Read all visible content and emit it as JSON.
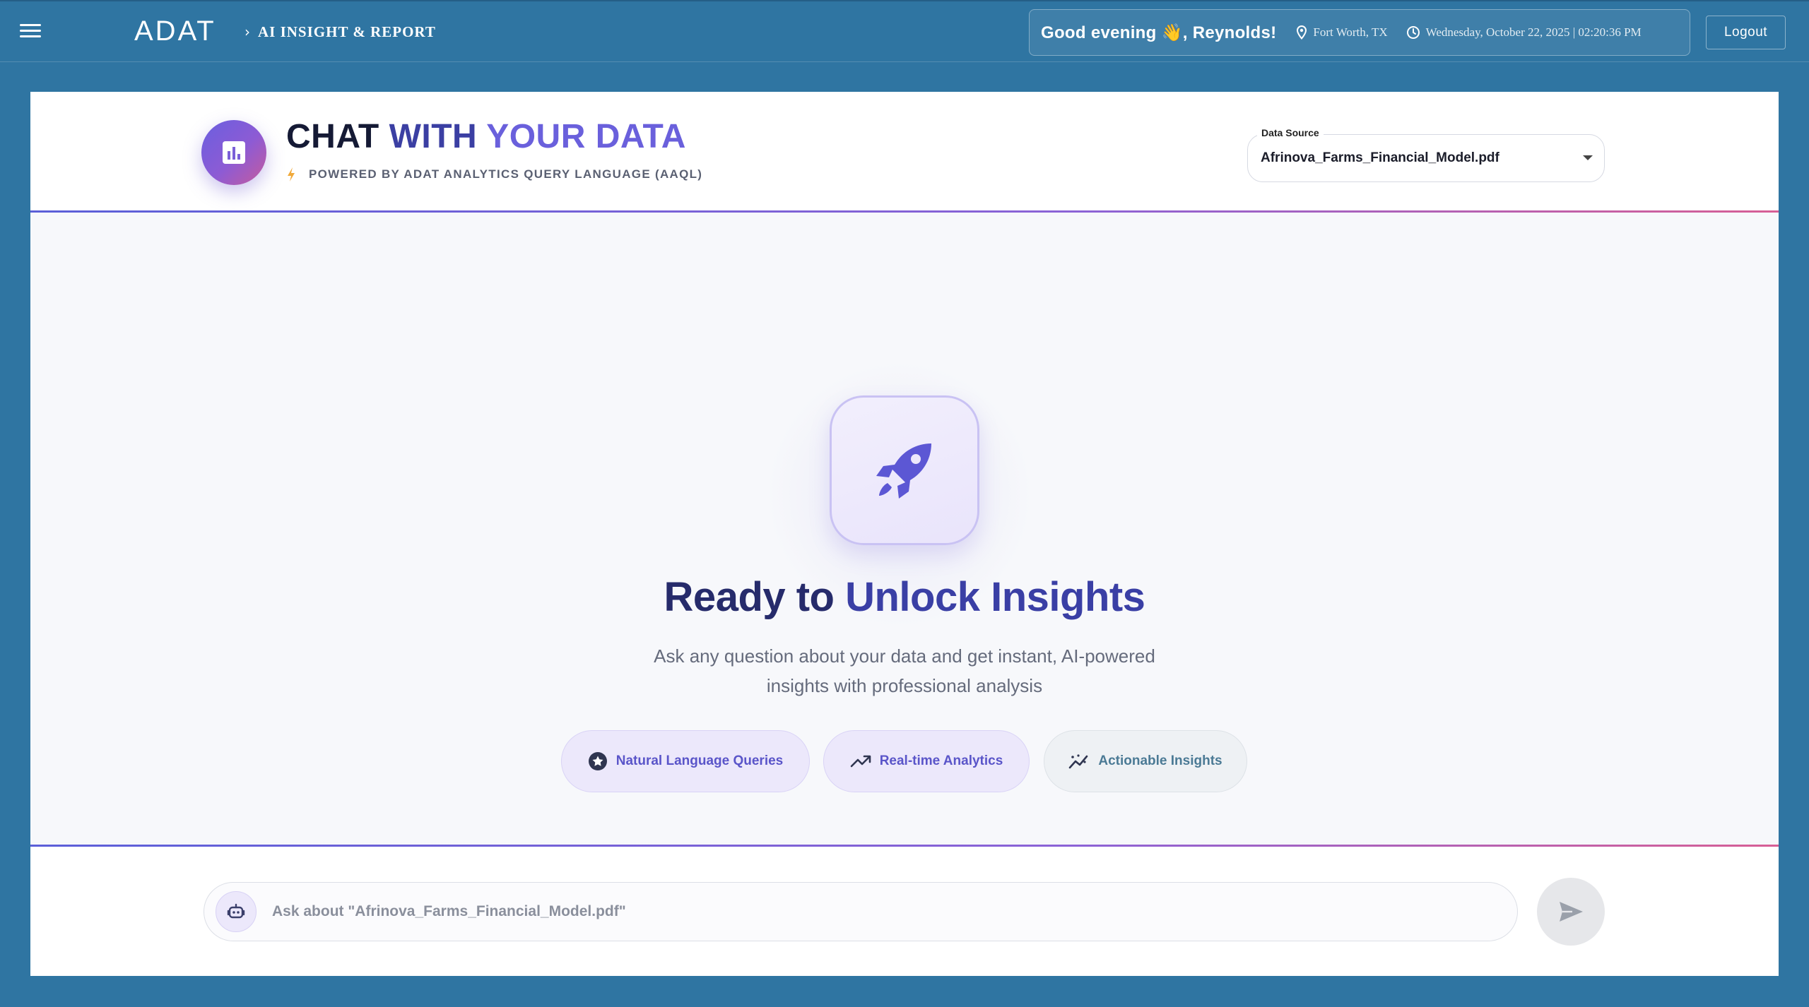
{
  "header": {
    "brand": "ADAT",
    "breadcrumb": "AI INSIGHT & REPORT",
    "greeting": "Good evening 👋, Reynolds!",
    "location": "Fort Worth, TX",
    "datetime": "Wednesday, October 22, 2025 | 02:20:36 PM",
    "logout_label": "Logout"
  },
  "page": {
    "title_part1": "CHAT ",
    "title_part2": "WITH ",
    "title_part3": "YOUR DATA",
    "subtitle": "POWERED BY ADAT ANALYTICS QUERY LANGUAGE (AAQL)",
    "data_source_label": "Data Source",
    "data_source_value": "Afrinova_Farms_Financial_Model.pdf"
  },
  "empty_state": {
    "heading_part1": "Ready to ",
    "heading_part2": "Unlock Insights",
    "description": "Ask any question about your data and get instant, AI-powered insights with professional analysis",
    "chips": [
      {
        "label": "Natural Language Queries",
        "icon": "star-circle-icon"
      },
      {
        "label": "Real-time Analytics",
        "icon": "trending-up-icon"
      },
      {
        "label": "Actionable Insights",
        "icon": "insights-icon"
      }
    ]
  },
  "chat_input": {
    "placeholder": "Ask about \"Afrinova_Farms_Financial_Model.pdf\"",
    "value": ""
  },
  "colors": {
    "topbar_bg": "#2f75a2",
    "accent_indigo": "#3b3fa3",
    "accent_violet": "#6a60dc",
    "accent_pink": "#d75f95"
  }
}
